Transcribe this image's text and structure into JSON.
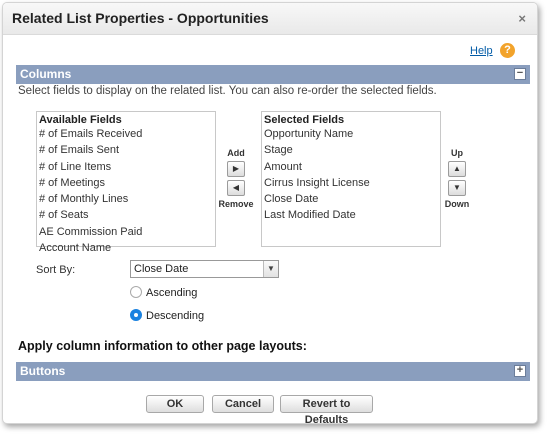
{
  "dialog": {
    "title": "Related List Properties - Opportunities",
    "close_symbol": "×"
  },
  "help": {
    "link_label": "Help",
    "icon_symbol": "?"
  },
  "columns_section": {
    "title": "Columns",
    "toggle_symbol": "−",
    "instructions": "Select fields to display on the related list. You can also re-order the selected fields."
  },
  "available_fields": {
    "heading": "Available Fields",
    "items": [
      "# of Emails Received",
      "# of Emails Sent",
      "# of Line Items",
      "# of Meetings",
      "# of Monthly Lines",
      "# of Seats",
      "AE Commission Paid",
      "Account Name"
    ]
  },
  "selected_fields": {
    "heading": "Selected Fields",
    "items": [
      "Opportunity Name",
      "Stage",
      "Amount",
      "Cirrus Insight License",
      "Close Date",
      "Last Modified Date"
    ]
  },
  "transfer": {
    "add_label": "Add",
    "remove_label": "Remove",
    "add_icon": "▶",
    "remove_icon": "◀"
  },
  "order": {
    "up_label": "Up",
    "down_label": "Down",
    "up_icon": "▲",
    "down_icon": "▼"
  },
  "sort": {
    "label": "Sort By:",
    "selected": "Close Date",
    "dropdown_icon": "▼",
    "ascending_label": "Ascending",
    "descending_label": "Descending",
    "direction": "Descending"
  },
  "apply_text": "Apply column information to other page layouts:",
  "buttons_section": {
    "title": "Buttons",
    "toggle_symbol": "+"
  },
  "footer": {
    "ok_label": "OK",
    "cancel_label": "Cancel",
    "revert_label": "Revert to Defaults"
  },
  "colors": {
    "section_bar": "#8a9ebe",
    "link": "#015ba7",
    "help_icon": "#f2a32b",
    "radio_selected": "#1b82e0"
  }
}
